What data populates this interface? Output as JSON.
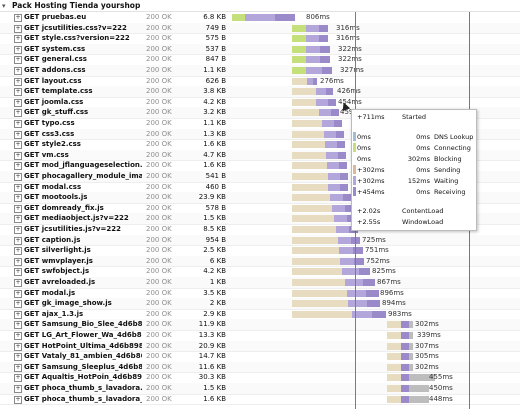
{
  "header": {
    "title": "Pack Hosting Tienda yourshop",
    "twisty": "▾"
  },
  "colors": {
    "waiting": "#e8dcc0",
    "connecting": "#c5df7a",
    "sending": "#b3a6da",
    "receiving": "#9b8ac9",
    "cached": "#bdbdbd",
    "contentload": "#5b7bd6",
    "windowload": "#b04ad6"
  },
  "requests": [
    {
      "label": "GET pruebas.eu",
      "status": "200 OK",
      "size": "6.8 KB",
      "time": "806ms"
    },
    {
      "label": "GET jcsutilities.css?v=222",
      "status": "200 OK",
      "size": "749 B",
      "time": "316ms"
    },
    {
      "label": "GET style.css?version=222",
      "status": "200 OK",
      "size": "575 B",
      "time": "316ms"
    },
    {
      "label": "GET system.css",
      "status": "200 OK",
      "size": "537 B",
      "time": "322ms"
    },
    {
      "label": "GET general.css",
      "status": "200 OK",
      "size": "847 B",
      "time": "322ms"
    },
    {
      "label": "GET addons.css",
      "status": "200 OK",
      "size": "1.1 KB",
      "time": "327ms"
    },
    {
      "label": "GET layout.css",
      "status": "200 OK",
      "size": "626 B",
      "time": "276ms"
    },
    {
      "label": "GET template.css",
      "status": "200 OK",
      "size": "3.8 KB",
      "time": "426ms"
    },
    {
      "label": "GET joomla.css",
      "status": "200 OK",
      "size": "4.2 KB",
      "time": "454ms"
    },
    {
      "label": "GET gk_stuff.css",
      "status": "200 OK",
      "size": "3.2 KB",
      "time": "459"
    },
    {
      "label": "GET typo.css",
      "status": "200 OK",
      "size": "1.1 KB",
      "time": ""
    },
    {
      "label": "GET css3.css",
      "status": "200 OK",
      "size": "1.3 KB",
      "time": ""
    },
    {
      "label": "GET style2.css",
      "status": "200 OK",
      "size": "1.6 KB",
      "time": ""
    },
    {
      "label": "GET vm.css",
      "status": "200 OK",
      "size": "4.7 KB",
      "time": ""
    },
    {
      "label": "GET mod_jflanguageselection.c",
      "status": "200 OK",
      "size": "1.6 KB",
      "time": ""
    },
    {
      "label": "GET phocagallery_module_imag",
      "status": "200 OK",
      "size": "541 B",
      "time": ""
    },
    {
      "label": "GET modal.css",
      "status": "200 OK",
      "size": "460 B",
      "time": ""
    },
    {
      "label": "GET mootools.js",
      "status": "200 OK",
      "size": "23.9 KB",
      "time": ""
    },
    {
      "label": "GET domready_fix.js",
      "status": "200 OK",
      "size": "578 B",
      "time": ""
    },
    {
      "label": "GET mediaobject.js?v=222",
      "status": "200 OK",
      "size": "1.5 KB",
      "time": ""
    },
    {
      "label": "GET jcsutilities.js?v=222",
      "status": "200 OK",
      "size": "8.5 KB",
      "time": ""
    },
    {
      "label": "GET caption.js",
      "status": "200 OK",
      "size": "954 B",
      "time": "725ms"
    },
    {
      "label": "GET silverlight.js",
      "status": "200 OK",
      "size": "2.5 KB",
      "time": "751ms"
    },
    {
      "label": "GET wmvplayer.js",
      "status": "200 OK",
      "size": "6 KB",
      "time": "752ms"
    },
    {
      "label": "GET swfobject.js",
      "status": "200 OK",
      "size": "4.2 KB",
      "time": "825ms"
    },
    {
      "label": "GET avreloaded.js",
      "status": "200 OK",
      "size": "1 KB",
      "time": "867ms"
    },
    {
      "label": "GET modal.js",
      "status": "200 OK",
      "size": "3.5 KB",
      "time": "896ms"
    },
    {
      "label": "GET gk_image_show.js",
      "status": "200 OK",
      "size": "2 KB",
      "time": "894ms"
    },
    {
      "label": "GET ajax_1.3.js",
      "status": "200 OK",
      "size": "2.9 KB",
      "time": "983ms"
    },
    {
      "label": "GET Samsung_Bio_Slee_4d6b87",
      "status": "200 OK",
      "size": "11.9 KB",
      "time": "302ms"
    },
    {
      "label": "GET LG_Art_Flower_Wa_4d6b89",
      "status": "200 OK",
      "size": "13.3 KB",
      "time": "339ms"
    },
    {
      "label": "GET HotPoint_Ultima_4d6b898",
      "status": "200 OK",
      "size": "20.9 KB",
      "time": "307ms"
    },
    {
      "label": "GET Vataly_81_ambien_4d6b86c",
      "status": "200 OK",
      "size": "14.7 KB",
      "time": "305ms"
    },
    {
      "label": "GET Samsung_Sleeplus_4d6b86",
      "status": "200 OK",
      "size": "11.6 KB",
      "time": "302ms"
    },
    {
      "label": "GET Aqualtis_HotPoin_4d6b892",
      "status": "200 OK",
      "size": "30.3 KB",
      "time": "455ms"
    },
    {
      "label": "GET phoca_thumb_s_lavadora.g",
      "status": "200 OK",
      "size": "1.5 KB",
      "time": "450ms"
    },
    {
      "label": "GET phoca_thumb_s_lavadora_g",
      "status": "200 OK",
      "size": "1.6 KB",
      "time": "448ms"
    }
  ],
  "tooltip": {
    "started": {
      "value": "+711ms",
      "label": "Started"
    },
    "phases": [
      {
        "start": "0ms",
        "duration": "0ms",
        "label": "DNS Lookup"
      },
      {
        "start": "0ms",
        "duration": "0ms",
        "label": "Connecting"
      },
      {
        "start": "0ms",
        "duration": "302ms",
        "label": "Blocking"
      },
      {
        "start": "+302ms",
        "duration": "0ms",
        "label": "Sending"
      },
      {
        "start": "+302ms",
        "duration": "152ms",
        "label": "Waiting"
      },
      {
        "start": "+454ms",
        "duration": "0ms",
        "label": "Receiving"
      }
    ],
    "contentload": {
      "value": "+2.02s",
      "label": "ContentLoad"
    },
    "windowload": {
      "value": "+2.55s",
      "label": "WindowLoad"
    }
  }
}
